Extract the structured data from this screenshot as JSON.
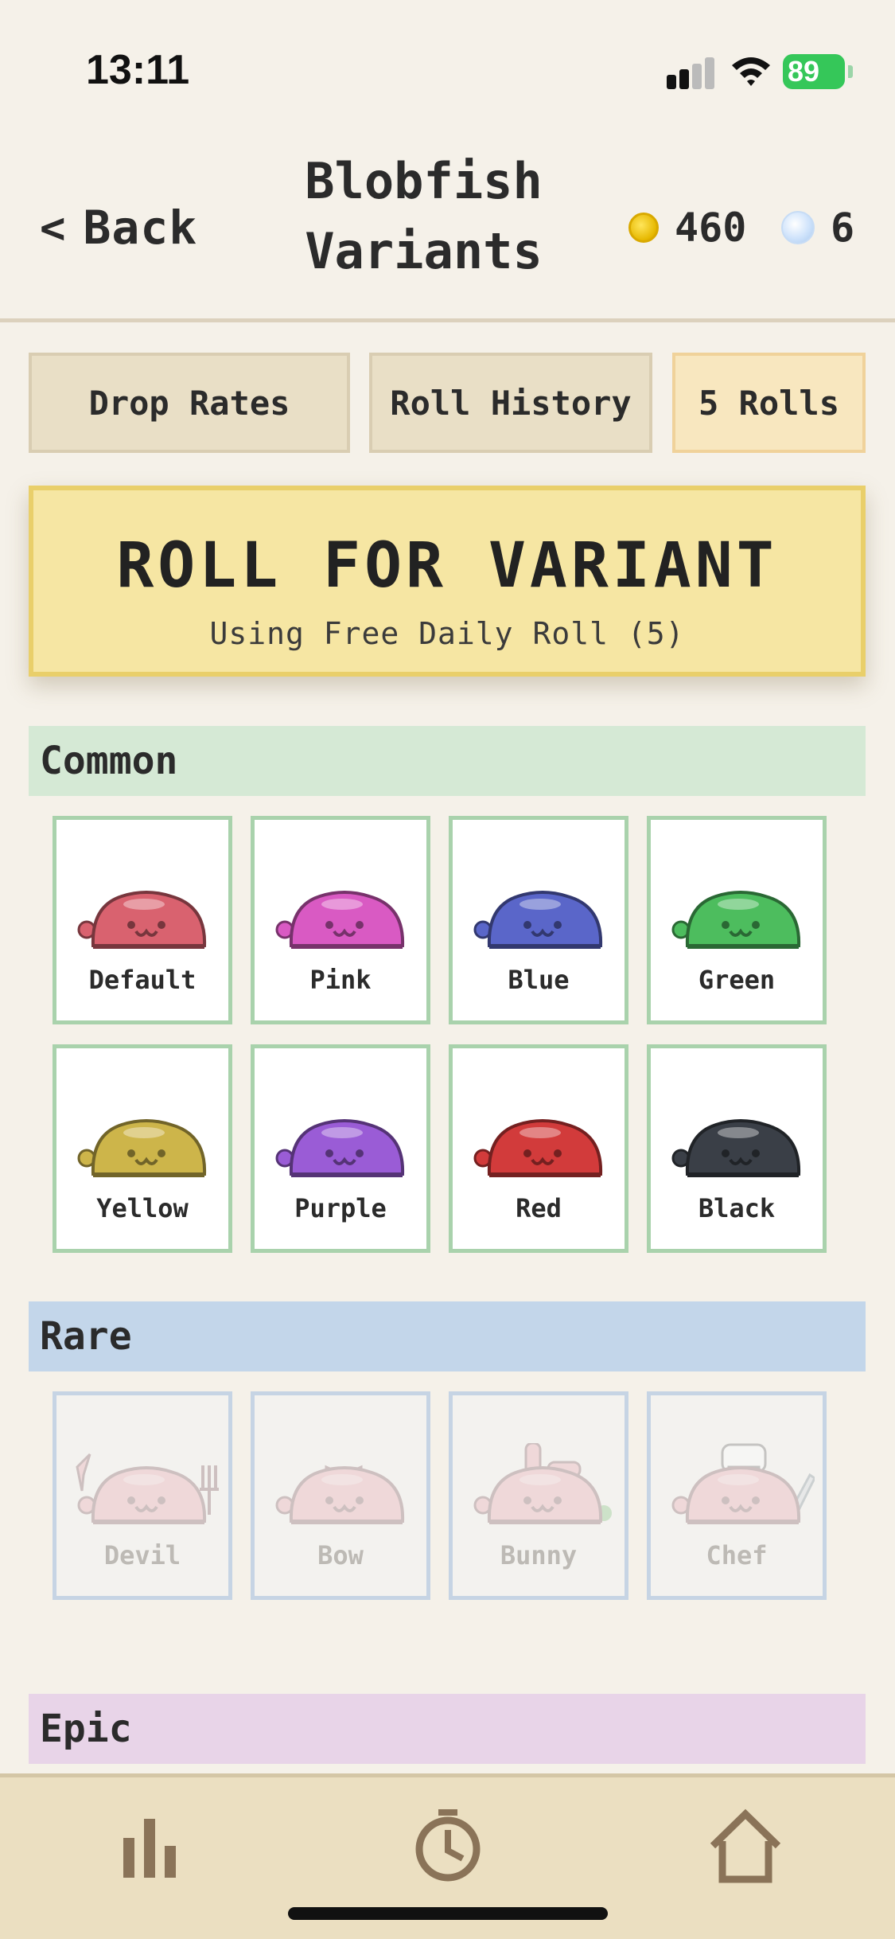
{
  "status_bar": {
    "time": "13:11",
    "battery": "89"
  },
  "header": {
    "back_label": "Back",
    "title_line1": "Blobfish",
    "title_line2": "Variants",
    "coins": "460",
    "gems": "6"
  },
  "tabs": {
    "drop_rates": "Drop Rates",
    "roll_history": "Roll History",
    "rolls": "5 Rolls"
  },
  "roll_button": {
    "title": "ROLL FOR VARIANT",
    "subtitle": "Using Free Daily Roll (5)"
  },
  "sections": {
    "common": {
      "title": "Common",
      "items": [
        {
          "label": "Default",
          "color": "#d9626f"
        },
        {
          "label": "Pink",
          "color": "#d95ac3"
        },
        {
          "label": "Blue",
          "color": "#5a66c9"
        },
        {
          "label": "Green",
          "color": "#4dbd5e"
        },
        {
          "label": "Yellow",
          "color": "#cdb54a"
        },
        {
          "label": "Purple",
          "color": "#9a5cd6"
        },
        {
          "label": "Red",
          "color": "#d23b3b"
        },
        {
          "label": "Black",
          "color": "#3a3f47"
        }
      ]
    },
    "rare": {
      "title": "Rare",
      "items": [
        {
          "label": "Devil",
          "color": "#e9a3ac"
        },
        {
          "label": "Bow",
          "color": "#e9a3ac"
        },
        {
          "label": "Bunny",
          "color": "#e9a3ac"
        },
        {
          "label": "Chef",
          "color": "#e9a3ac"
        }
      ]
    },
    "epic": {
      "title": "Epic"
    }
  },
  "bottom_nav": {
    "items": [
      {
        "icon": "bar-chart-icon"
      },
      {
        "icon": "clock-icon"
      },
      {
        "icon": "home-icon"
      }
    ]
  }
}
